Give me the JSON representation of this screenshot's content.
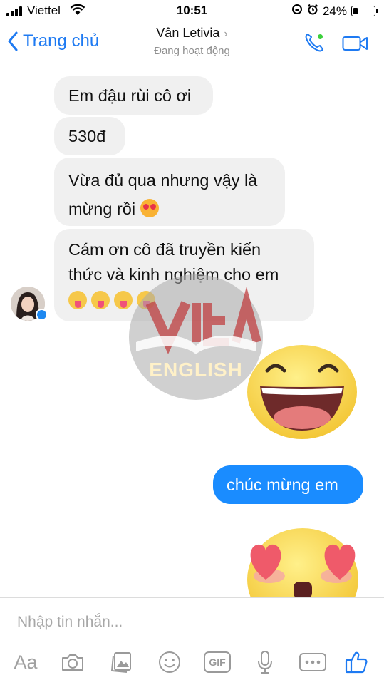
{
  "status_bar": {
    "carrier": "Viettel",
    "time": "10:51",
    "battery": "24%",
    "battery_level": 0.24
  },
  "header": {
    "back_label": "Trang chủ",
    "contact_name": "Vân Letivia",
    "status": "Đang hoạt động"
  },
  "messages": [
    {
      "from": "contact",
      "text": "Em đậu rùi cô ơi"
    },
    {
      "from": "contact",
      "text": "530đ"
    },
    {
      "from": "contact",
      "lines": [
        "Vừa đủ qua nhưng vậy là",
        "mừng rồi"
      ],
      "emoji": [
        "heart-eyes-emoji"
      ]
    },
    {
      "from": "contact",
      "lines": [
        "Cám ơn cô đã truyền kiến",
        "thức và kinh nghiệm cho em"
      ],
      "emoji": [
        "tongue-emoji",
        "tongue-emoji",
        "tongue-emoji",
        "tongue-emoji"
      ]
    },
    {
      "from": "me",
      "sticker": "laughing-face-sticker"
    },
    {
      "from": "me",
      "text": "chúc mừng em"
    },
    {
      "from": "me",
      "sticker": "heart-eyes-sticker"
    }
  ],
  "watermark": {
    "text": "ENGLISH"
  },
  "composer": {
    "placeholder": "Nhập tin nhắn...",
    "aa_label": "Aa",
    "gif_label": "GIF",
    "icons": [
      "camera-icon",
      "gallery-icon",
      "emoji-icon",
      "gif-icon",
      "microphone-icon",
      "more-icon",
      "thumbs-up-icon"
    ]
  },
  "colors": {
    "accent": "#1e7af2",
    "outgoing_bubble": "#1a8cff",
    "incoming_bubble": "#f0f0f0",
    "online": "#3cd03c"
  }
}
